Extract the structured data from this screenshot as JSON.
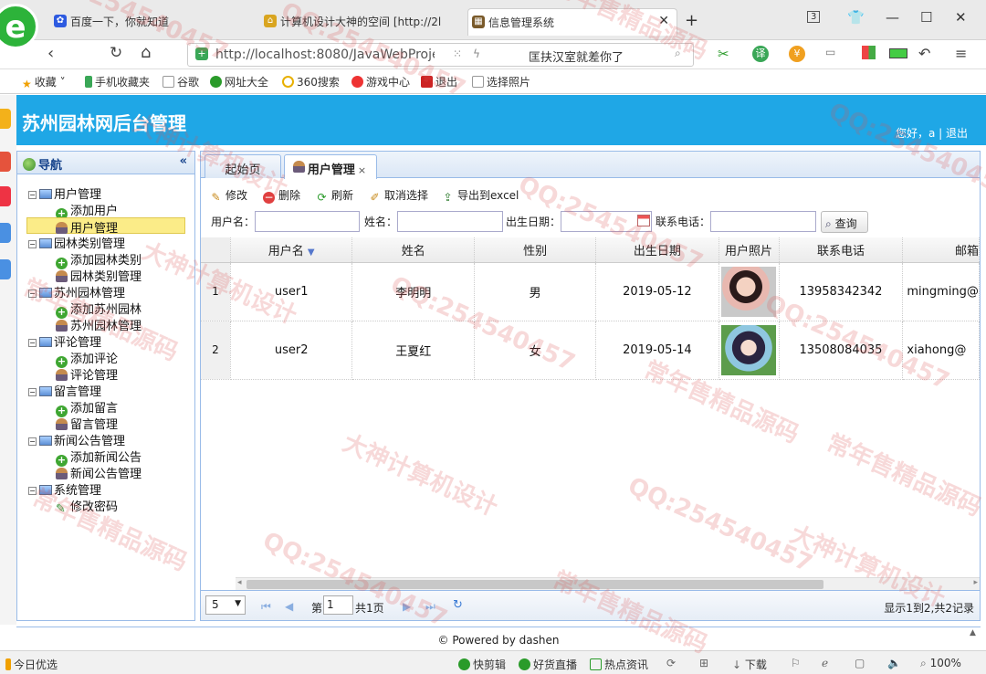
{
  "browser": {
    "tabs": [
      {
        "label": "百度一下，你就知道"
      },
      {
        "label": "计算机设计大神的空间 [http://2l"
      },
      {
        "label": "信息管理系统"
      }
    ],
    "tab_count": "3",
    "url": "http://localhost:8080/JavaWebProje",
    "search_placeholder": "匡扶汉室就差你了",
    "translate": "译",
    "bookmarks": [
      "收藏",
      "手机收藏夹",
      "谷歌",
      "网址大全",
      "360搜索",
      "游戏中心",
      "退出",
      "选择照片"
    ],
    "status_items": [
      "今日优选",
      "快剪辑",
      "好货直播",
      "热点资讯",
      "下载",
      "100%"
    ]
  },
  "app": {
    "title": "苏州园林网后台管理",
    "greeting": "您好，a | 退出",
    "footer": "© Powered by dashen"
  },
  "nav": {
    "title": "导航",
    "collapse": "«",
    "groups": [
      {
        "label": "用户管理",
        "items": [
          {
            "label": "添加用户",
            "icon": "add-icon"
          },
          {
            "label": "用户管理",
            "icon": "user-icon",
            "selected": true
          }
        ]
      },
      {
        "label": "园林类别管理",
        "items": [
          {
            "label": "添加园林类别",
            "icon": "add-icon"
          },
          {
            "label": "园林类别管理",
            "icon": "user-icon"
          }
        ]
      },
      {
        "label": "苏州园林管理",
        "items": [
          {
            "label": "添加苏州园林",
            "icon": "add-icon"
          },
          {
            "label": "苏州园林管理",
            "icon": "user-icon"
          }
        ]
      },
      {
        "label": "评论管理",
        "items": [
          {
            "label": "添加评论",
            "icon": "add-icon"
          },
          {
            "label": "评论管理",
            "icon": "user-icon"
          }
        ]
      },
      {
        "label": "留言管理",
        "items": [
          {
            "label": "添加留言",
            "icon": "add-icon"
          },
          {
            "label": "留言管理",
            "icon": "user-icon"
          }
        ]
      },
      {
        "label": "新闻公告管理",
        "items": [
          {
            "label": "添加新闻公告",
            "icon": "add-icon"
          },
          {
            "label": "新闻公告管理",
            "icon": "user-icon"
          }
        ]
      },
      {
        "label": "系统管理",
        "items": [
          {
            "label": "修改密码",
            "icon": "pencil-icon"
          }
        ]
      }
    ]
  },
  "main": {
    "tabs": [
      {
        "label": "起始页"
      },
      {
        "label": "用户管理",
        "close": "×"
      }
    ],
    "toolbar": {
      "edit": "修改",
      "delete": "删除",
      "refresh": "刷新",
      "unselect": "取消选择",
      "export": "导出到excel"
    },
    "search": {
      "username_label": "用户名：",
      "name_label": "姓名：",
      "birth_label": "出生日期：",
      "phone_label": "联系电话：",
      "button": "查询"
    },
    "columns": [
      "用户名",
      "姓名",
      "性别",
      "出生日期",
      "用户照片",
      "联系电话",
      "邮箱"
    ],
    "rows": [
      {
        "num": "1",
        "username": "user1",
        "name": "李明明",
        "gender": "男",
        "birth": "2019-05-12",
        "phone": "13958342342",
        "email": "mingming@"
      },
      {
        "num": "2",
        "username": "user2",
        "name": "王夏红",
        "gender": "女",
        "birth": "2019-05-14",
        "phone": "13508084035",
        "email": "xiahong@"
      }
    ],
    "pager": {
      "page_size": "5",
      "page_prefix": "第",
      "page_value": "1",
      "page_suffix": "共1页",
      "summary": "显示1到2,共2记录"
    }
  },
  "watermarks": [
    "QQ:254540457",
    "大神计算机设计",
    "常年售精品源码"
  ],
  "colors": {
    "header": "#1fa7e6",
    "panel_border": "#99bbe8"
  }
}
